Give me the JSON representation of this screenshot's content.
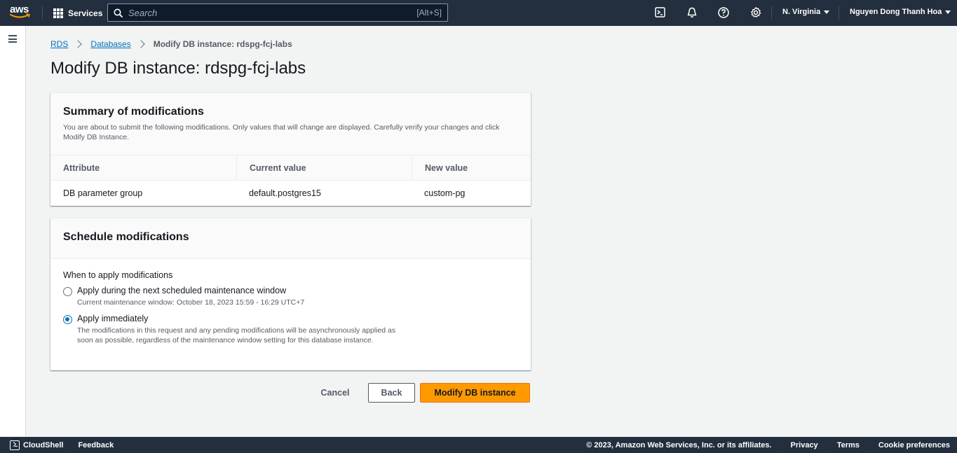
{
  "topnav": {
    "logo_text": "aws",
    "services_label": "Services",
    "search_placeholder": "Search",
    "search_shortcut": "[Alt+S]",
    "region": "N. Virginia",
    "user": "Nguyen Dong Thanh Hoa"
  },
  "breadcrumb": {
    "items": [
      "RDS",
      "Databases"
    ],
    "current": "Modify DB instance: rdspg-fcj-labs"
  },
  "page_title": "Modify DB instance: rdspg-fcj-labs",
  "summary": {
    "title": "Summary of modifications",
    "description": "You are about to submit the following modifications. Only values that will change are displayed. Carefully verify your changes and click Modify DB Instance.",
    "columns": [
      "Attribute",
      "Current value",
      "New value"
    ],
    "rows": [
      [
        "DB parameter group",
        "default.postgres15",
        "custom-pg"
      ]
    ]
  },
  "schedule": {
    "title": "Schedule modifications",
    "field_label": "When to apply modifications",
    "options": [
      {
        "label": "Apply during the next scheduled maintenance window",
        "description": "Current maintenance window: October 18, 2023 15:59 - 16:29 UTC+7",
        "selected": false
      },
      {
        "label": "Apply immediately",
        "description": "The modifications in this request and any pending modifications will be asynchronously applied as soon as possible, regardless of the maintenance window setting for this database instance.",
        "selected": true
      }
    ]
  },
  "actions": {
    "cancel": "Cancel",
    "back": "Back",
    "primary": "Modify DB instance"
  },
  "footer": {
    "cloudshell": "CloudShell",
    "feedback": "Feedback",
    "copyright": "© 2023, Amazon Web Services, Inc. or its affiliates.",
    "privacy": "Privacy",
    "terms": "Terms",
    "cookies": "Cookie preferences"
  },
  "colors": {
    "nav_bg": "#232f3e",
    "primary_button": "#ff9900",
    "link": "#0073bb"
  }
}
